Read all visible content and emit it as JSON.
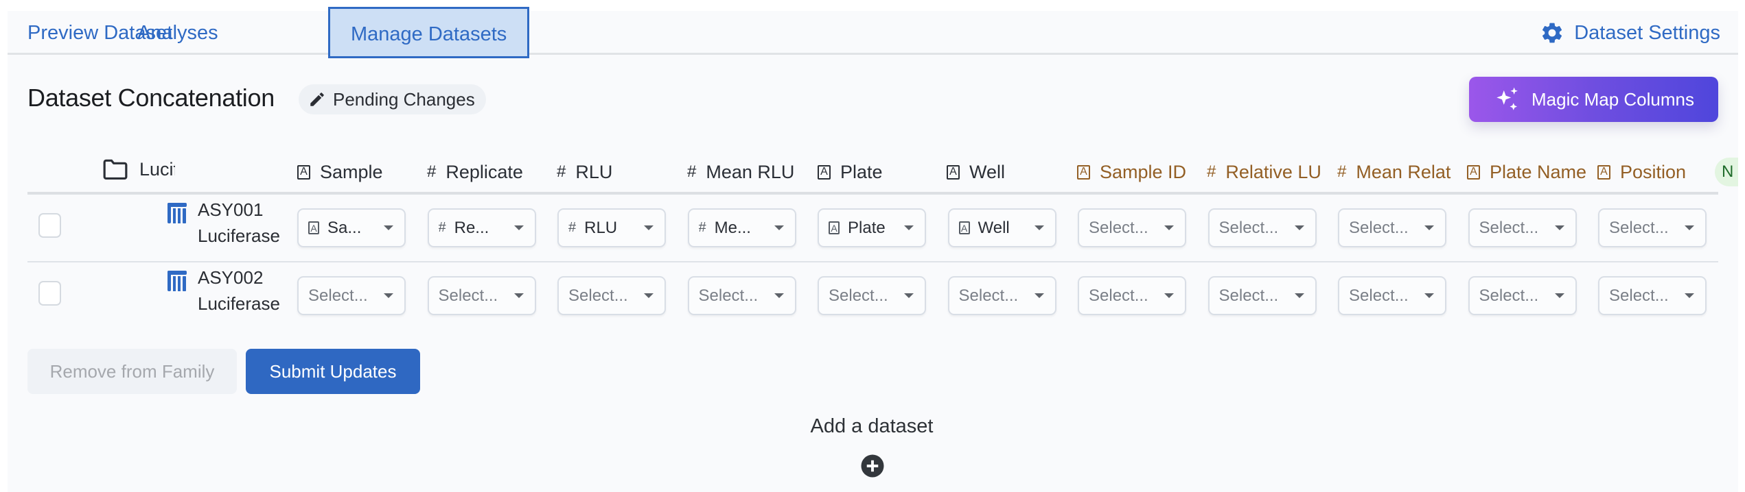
{
  "tabs": [
    {
      "label": "Preview Dataset",
      "active": false
    },
    {
      "label": "Analyses",
      "active": false
    },
    {
      "label": "Manage Datasets",
      "active": true
    }
  ],
  "settings": {
    "label": "Dataset Settings",
    "icon": "gear-icon"
  },
  "section": {
    "title": "Dataset Concatenation",
    "status_badge": {
      "label": "Pending Changes",
      "icon": "pencil-icon"
    },
    "magic_button": {
      "label": "Magic Map Columns",
      "icon": "sparkles-icon"
    }
  },
  "colors": {
    "accent": "#2f6ac4",
    "matched_header": "#2b2f36",
    "unmatched_header": "#935f25",
    "magic_gradient_start": "#9b57ea",
    "magic_gradient_end": "#4f46dc",
    "new_badge_bg": "#e3f5e1"
  },
  "table": {
    "family_column": {
      "label": "Luciferase",
      "icon": "folder-icon"
    },
    "columns": [
      {
        "label": "Sample",
        "type": "text",
        "status": "matched"
      },
      {
        "label": "Replicate",
        "type": "number",
        "status": "matched"
      },
      {
        "label": "RLU",
        "type": "number",
        "status": "matched"
      },
      {
        "label": "Mean RLU",
        "type": "number",
        "status": "matched"
      },
      {
        "label": "Plate",
        "type": "text",
        "status": "matched"
      },
      {
        "label": "Well",
        "type": "text",
        "status": "matched"
      },
      {
        "label": "Sample ID",
        "type": "text",
        "status": "unmatched"
      },
      {
        "label": "Relative LU",
        "type": "number",
        "status": "unmatched"
      },
      {
        "label": "Mean Relat",
        "type": "number",
        "status": "unmatched"
      },
      {
        "label": "Plate Name",
        "type": "text",
        "status": "unmatched"
      },
      {
        "label": "Position",
        "type": "text",
        "status": "unmatched"
      }
    ],
    "trailing_badge": "N",
    "select_placeholder": "Select...",
    "rows": [
      {
        "id": "ASY001",
        "name": "Luciferase",
        "checked": false,
        "mappings": [
          {
            "value": "Sa...",
            "type": "text"
          },
          {
            "value": "Re...",
            "type": "number"
          },
          {
            "value": "RLU",
            "type": "number"
          },
          {
            "value": "Me...",
            "type": "number"
          },
          {
            "value": "Plate",
            "type": "text"
          },
          {
            "value": "Well",
            "type": "text"
          },
          null,
          null,
          null,
          null,
          null
        ]
      },
      {
        "id": "ASY002",
        "name": "Luciferase",
        "checked": false,
        "mappings": [
          null,
          null,
          null,
          null,
          null,
          null,
          null,
          null,
          null,
          null,
          null
        ]
      }
    ]
  },
  "actions": {
    "remove_label": "Remove from Family",
    "submit_label": "Submit Updates"
  },
  "add_dataset": {
    "label": "Add a dataset",
    "icon": "plus-circle-icon"
  }
}
